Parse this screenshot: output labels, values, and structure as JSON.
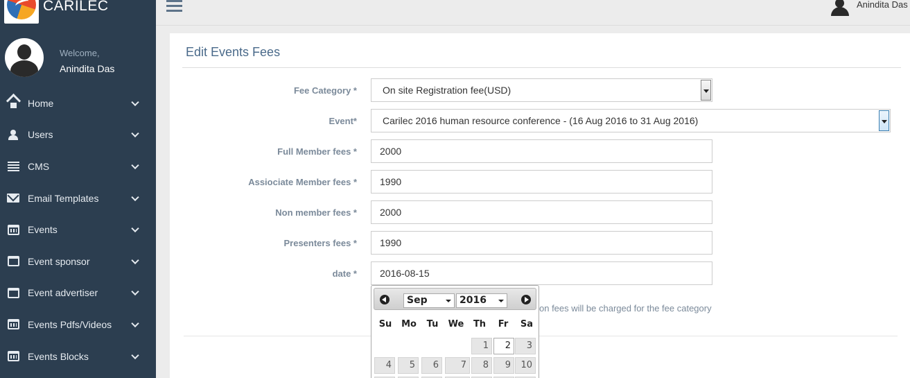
{
  "brand": {
    "name": "CARILEC"
  },
  "profile": {
    "welcome": "Welcome,",
    "name": "Anindita Das"
  },
  "topbar": {
    "user_name": "Anindita Das"
  },
  "nav": [
    {
      "label": "Home",
      "icon": "home-icon"
    },
    {
      "label": "Users",
      "icon": "user-icon"
    },
    {
      "label": "CMS",
      "icon": "list-icon"
    },
    {
      "label": "Email Templates",
      "icon": "envelope-icon"
    },
    {
      "label": "Events",
      "icon": "calendar-icon"
    },
    {
      "label": "Event sponsor",
      "icon": "calendar-icon"
    },
    {
      "label": "Event advertiser",
      "icon": "calendar-icon"
    },
    {
      "label": "Events Pdfs/Videos",
      "icon": "calendar-icon"
    },
    {
      "label": "Events Blocks",
      "icon": "calendar-icon"
    }
  ],
  "page": {
    "title": "Edit Events Fees"
  },
  "form": {
    "fee_category": {
      "label": "Fee Category *",
      "value": "On site Registration fee(USD)"
    },
    "event": {
      "label": "Event*",
      "value": "Carilec 2016 human resource conference - (16 Aug 2016 to 31 Aug 2016)"
    },
    "full_member": {
      "label": "Full Member fees *",
      "value": "2000"
    },
    "associate_member": {
      "label": "Assiociate Member fees *",
      "value": "1990"
    },
    "non_member": {
      "label": "Non member fees *",
      "value": "2000"
    },
    "presenters": {
      "label": "Presenters fees *",
      "value": "1990"
    },
    "date": {
      "label": "date *",
      "value": "2016-08-15"
    },
    "hint": "on fees will be charged for the fee category"
  },
  "datepicker": {
    "month": "Sep",
    "year": "2016",
    "weekdays": [
      "Su",
      "Mo",
      "Tu",
      "We",
      "Th",
      "Fr",
      "Sa"
    ],
    "row1": [
      "1",
      "2",
      "3"
    ],
    "row2": [
      "4",
      "5",
      "6",
      "7",
      "8",
      "9",
      "10"
    ]
  },
  "colors": {
    "sidebar": "#2c3e50",
    "title": "#4a6a8a",
    "label": "#7b8a9a"
  }
}
